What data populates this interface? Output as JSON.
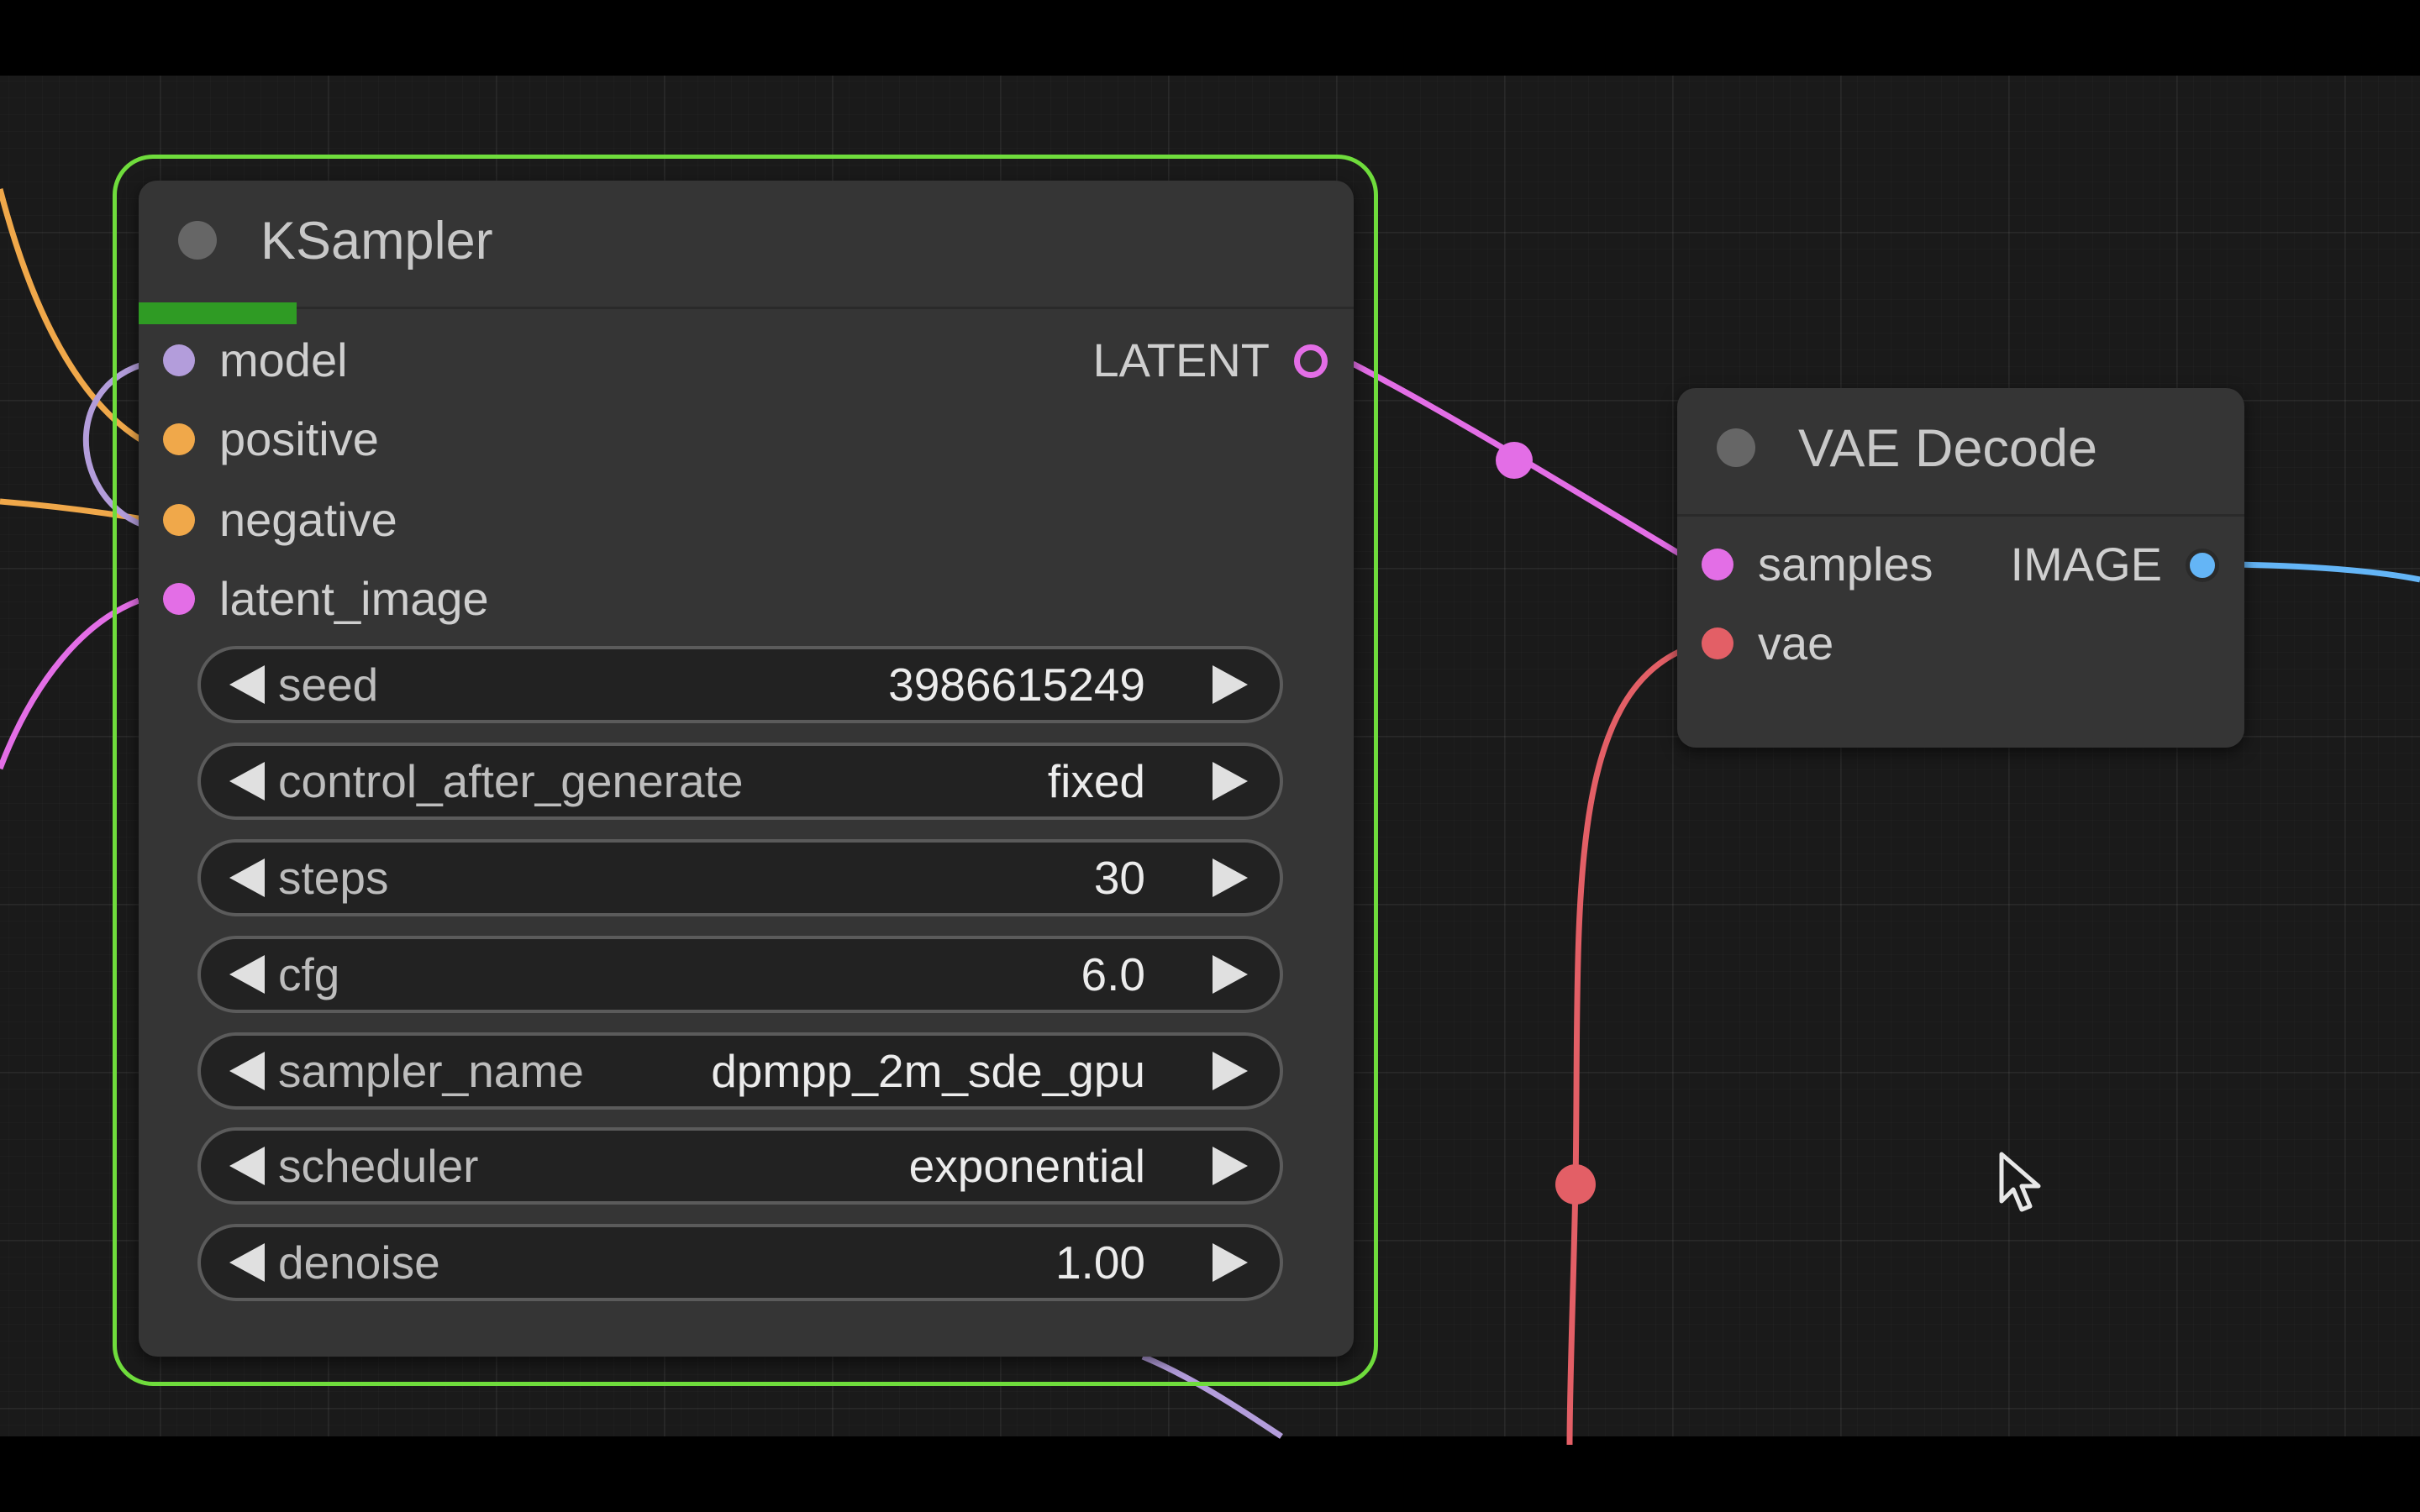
{
  "ksampler": {
    "title": "KSampler",
    "inputs": [
      {
        "label": "model",
        "color": "#b39ddb"
      },
      {
        "label": "positive",
        "color": "#f0a84a"
      },
      {
        "label": "negative",
        "color": "#f0a84a"
      },
      {
        "label": "latent_image",
        "color": "#e36ee6"
      }
    ],
    "output": {
      "label": "LATENT",
      "color": "#e36ee6"
    },
    "progress": 0.13,
    "widgets": [
      {
        "name": "seed",
        "value": "3986615249"
      },
      {
        "name": "control_after_generate",
        "value": "fixed"
      },
      {
        "name": "steps",
        "value": "30"
      },
      {
        "name": "cfg",
        "value": "6.0"
      },
      {
        "name": "sampler_name",
        "value": "dpmpp_2m_sde_gpu"
      },
      {
        "name": "scheduler",
        "value": "exponential"
      },
      {
        "name": "denoise",
        "value": "1.00"
      }
    ]
  },
  "vae_decode": {
    "title": "VAE Decode",
    "inputs": [
      {
        "label": "samples",
        "color": "#e36ee6"
      },
      {
        "label": "vae",
        "color": "#e35f66"
      }
    ],
    "output": {
      "label": "IMAGE",
      "color": "#64b5f6"
    }
  },
  "colors": {
    "selection": "#6fdc3c",
    "progress": "#2f9b24",
    "link_model": "#b39ddb",
    "link_conditioning": "#f0a84a",
    "link_latent": "#e36ee6",
    "link_vae": "#e35f66",
    "link_image": "#64b5f6"
  },
  "icons": {
    "cursor": "mouse-pointer-icon"
  }
}
